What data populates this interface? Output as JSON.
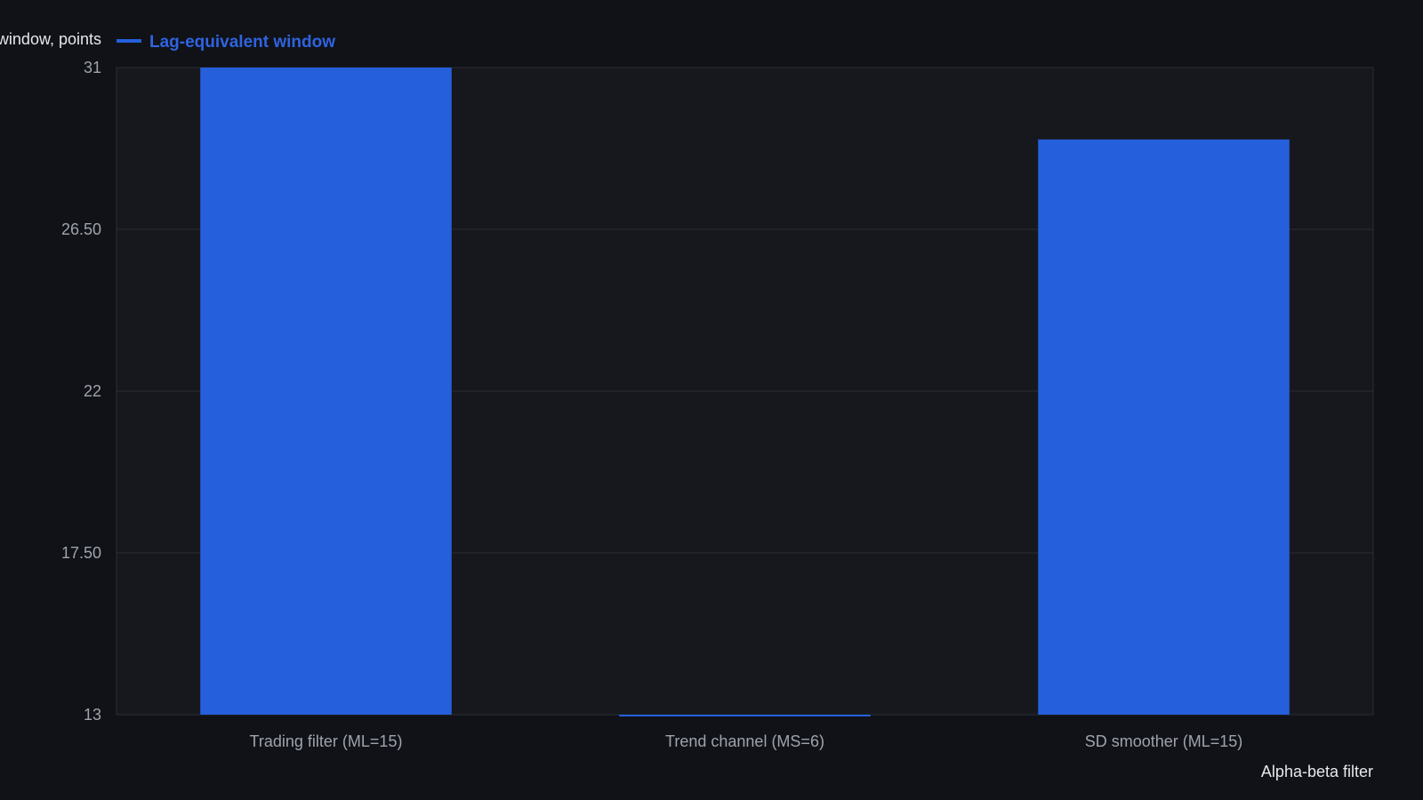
{
  "chart_data": {
    "type": "bar",
    "categories": [
      "Trading filter (ML=15)",
      "Trend channel (MS=6)",
      "SD smoother (ML=15)"
    ],
    "series": [
      {
        "name": "Lag-equivalent window",
        "values": [
          31,
          13,
          29
        ],
        "color": "#255fdc"
      }
    ],
    "yticks": [
      "13",
      "17.50",
      "22",
      "26.50",
      "31"
    ],
    "ytick_values": [
      13,
      17.5,
      22,
      26.5,
      31
    ],
    "ylim": [
      13,
      31
    ],
    "ylabel": "Lag-equivalent window, points",
    "xlabel": "Alpha-beta filter",
    "grid": true,
    "legend": "top-left"
  },
  "colors": {
    "background": "#101217",
    "plot_background": "#16181d",
    "grid": "#2a2d33",
    "bar": "#255fdc",
    "legend_text": "#2f63e0"
  }
}
